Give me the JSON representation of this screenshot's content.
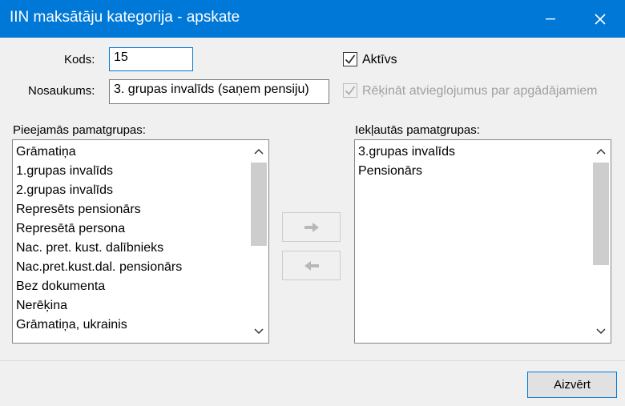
{
  "window": {
    "title": "IIN maksātāju kategorija - apskate",
    "minimize_icon": "minimize-icon",
    "close_icon": "close-icon"
  },
  "form": {
    "kods_label": "Kods:",
    "kods_value": "15",
    "nosaukums_label": "Nosaukums:",
    "nosaukums_value": "3. grupas invalīds (saņem pensiju)",
    "aktivs_label": "Aktīvs",
    "aktivs_checked": true,
    "rekinat_label": "Rēķināt atvieglojumus par apgādājamiem",
    "rekinat_checked": true,
    "rekinat_disabled": true
  },
  "available": {
    "label": "Pieejamās pamatgrupas:",
    "items": [
      "Grāmatiņa",
      "1.grupas invalīds",
      "2.grupas invalīds",
      "Represēts pensionārs",
      "Represētā persona",
      "Nac. pret. kust. dalībnieks",
      "Nac.pret.kust.dal. pensionārs",
      "Bez dokumenta",
      "Nerēķina",
      "Grāmatiņa, ukrainis"
    ]
  },
  "included": {
    "label": "Iekļautās pamatgrupas:",
    "items": [
      "3.grupas invalīds",
      "Pensionārs"
    ]
  },
  "buttons": {
    "move_right_icon": "arrow-right-icon",
    "move_left_icon": "arrow-left-icon",
    "close_label": "Aizvērt"
  },
  "colors": {
    "titlebar": "#0078d7",
    "accent": "#0078d7",
    "disabled_text": "#a0a0a0"
  }
}
